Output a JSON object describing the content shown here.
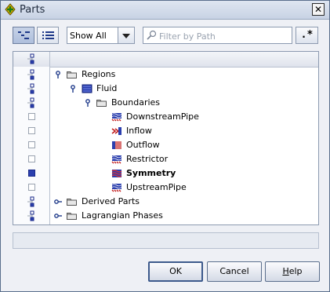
{
  "window": {
    "title": "Parts"
  },
  "toolbar": {
    "view_filter": "Show All",
    "filter_placeholder": "Filter by Path",
    "regex_label": ".*"
  },
  "tree": {
    "rows": [
      {
        "name": "Regions",
        "checkbox": "tree",
        "level": 0,
        "expander": "expanded",
        "icon": "folder-icon"
      },
      {
        "name": "Fluid",
        "checkbox": "tree",
        "level": 1,
        "expander": "expanded",
        "icon": "region-icon"
      },
      {
        "name": "Boundaries",
        "checkbox": "tree",
        "level": 2,
        "expander": "expanded",
        "icon": "folder-icon"
      },
      {
        "name": "DownstreamPipe",
        "checkbox": "empty",
        "level": 3,
        "icon": "boundary-wall-icon"
      },
      {
        "name": "Inflow",
        "checkbox": "empty",
        "level": 3,
        "icon": "boundary-inlet-icon"
      },
      {
        "name": "Outflow",
        "checkbox": "empty",
        "level": 3,
        "icon": "boundary-outlet-icon"
      },
      {
        "name": "Restrictor",
        "checkbox": "empty",
        "level": 3,
        "icon": "boundary-wall-icon"
      },
      {
        "name": "Symmetry",
        "checkbox": "filled",
        "level": 3,
        "icon": "boundary-symmetry-icon",
        "bold": true
      },
      {
        "name": "UpstreamPipe",
        "checkbox": "empty",
        "level": 3,
        "icon": "boundary-wall-icon"
      },
      {
        "name": "Derived Parts",
        "checkbox": "tree",
        "level": 0,
        "expander": "collapsed",
        "icon": "folder-icon"
      },
      {
        "name": "Lagrangian Phases",
        "checkbox": "tree",
        "level": 0,
        "expander": "collapsed",
        "icon": "folder-icon"
      }
    ]
  },
  "buttons": {
    "ok": "OK",
    "cancel": "Cancel",
    "help_mnemonic": "H",
    "help_rest": "elp"
  },
  "colors": {
    "accent": "#2b3fae",
    "title_bar": "#c7d2e4"
  }
}
